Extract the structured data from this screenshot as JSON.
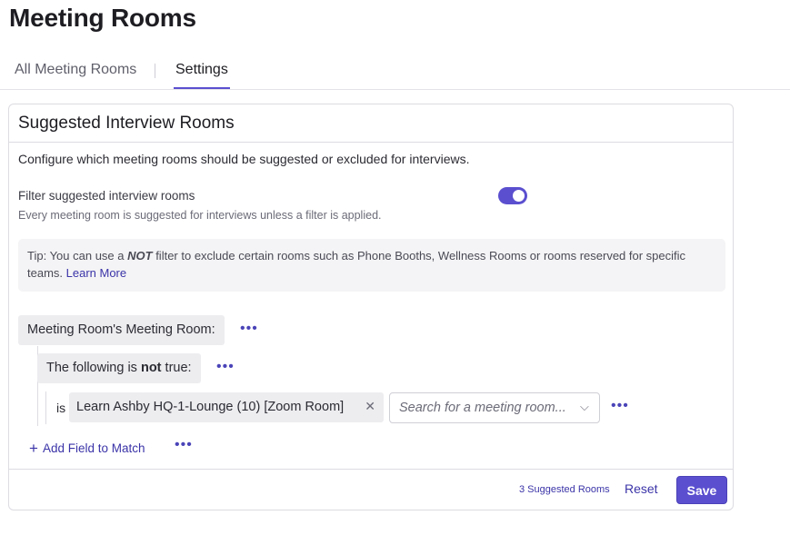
{
  "page": {
    "title": "Meeting Rooms"
  },
  "tabs": [
    {
      "label": "All Meeting Rooms"
    },
    {
      "label": "Settings",
      "active": true
    }
  ],
  "card": {
    "title": "Suggested Interview Rooms",
    "description": "Configure which meeting rooms should be suggested or excluded for interviews.",
    "filter": {
      "label": "Filter suggested interview rooms",
      "help": "Every meeting room is suggested for interviews unless a filter is applied.",
      "enabled": true
    },
    "tip": {
      "prefix": "Tip:",
      "text_before": " You can use a ",
      "emphasis": "NOT",
      "text_after": " filter to exclude certain rooms such as Phone Booths, Wellness Rooms or rooms reserved for specific teams. ",
      "link": "Learn More"
    },
    "rule": {
      "field_label": "Meeting Room's Meeting Room:",
      "negation_prefix": "The following is ",
      "negation_bold": "not",
      "negation_suffix": " true:",
      "operator": "is",
      "value": "Learn Ashby HQ-1-Lounge (10) [Zoom Room]",
      "search_placeholder": "Search for a meeting room...",
      "more_icon": "ellipsis-icon",
      "remove_icon": "close-icon"
    },
    "add_field": "Add Field to Match",
    "footer": {
      "suggested_count": "3 Suggested Rooms",
      "reset": "Reset",
      "save": "Save"
    }
  },
  "colors": {
    "accent": "#5b4fcf",
    "link": "#3b34a8",
    "chip": "#ededf0"
  }
}
